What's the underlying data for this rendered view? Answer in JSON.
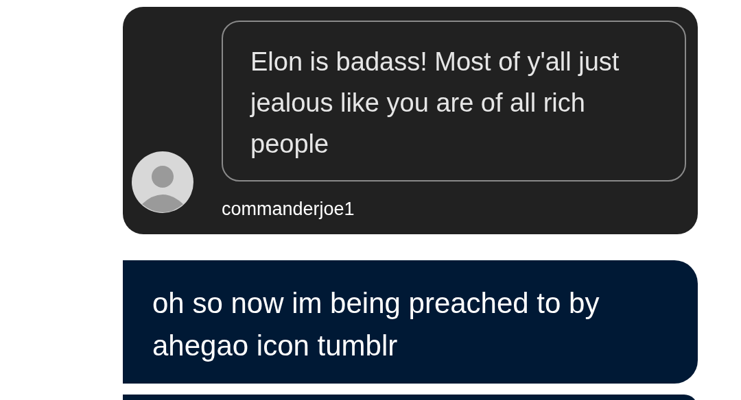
{
  "reblog": {
    "reply_text": "Elon is badass! Most of y'all just jealous like you are of all rich people",
    "username": "commanderjoe1"
  },
  "answer": {
    "text": "oh so now im being preached to by ahegao icon tumblr"
  }
}
